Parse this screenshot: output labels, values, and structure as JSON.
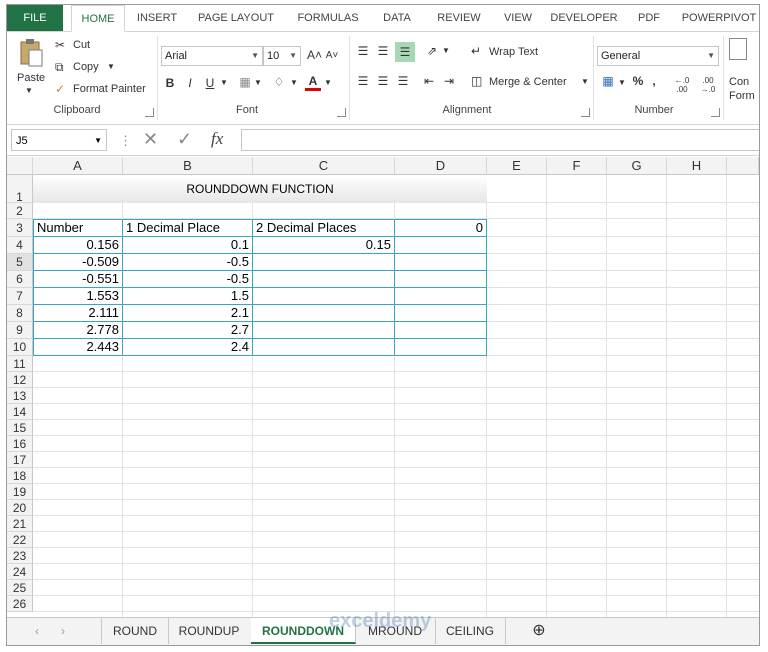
{
  "ribbon_tabs": [
    "FILE",
    "HOME",
    "INSERT",
    "PAGE LAYOUT",
    "FORMULAS",
    "DATA",
    "REVIEW",
    "VIEW",
    "DEVELOPER",
    "PDF",
    "POWERPIVOT"
  ],
  "clipboard": {
    "paste": "Paste",
    "cut": "Cut",
    "copy": "Copy",
    "format_painter": "Format Painter",
    "label": "Clipboard"
  },
  "font": {
    "name": "Arial",
    "size": "10",
    "label": "Font",
    "bold": "B",
    "italic": "I",
    "underline": "U",
    "grow": "A˄",
    "shrink": "A˅",
    "font_color": "A"
  },
  "alignment": {
    "wrap_text": "Wrap Text",
    "merge_center": "Merge & Center",
    "label": "Alignment"
  },
  "number": {
    "format": "General",
    "percent": "%",
    "comma": ",",
    "inc_decimal": "←.0 .00",
    "dec_decimal": ".00 →.0",
    "label": "Number"
  },
  "styles_partial": {
    "line1": "Con",
    "line2": "Form"
  },
  "formula_bar": {
    "name_box": "J5",
    "fx": "fx",
    "cancel": "✕",
    "enter": "✓",
    "more": "⋮",
    "value": ""
  },
  "columns": [
    "A",
    "B",
    "C",
    "D",
    "E",
    "F",
    "G",
    "H"
  ],
  "rows": [
    "1",
    "2",
    "3",
    "4",
    "5",
    "6",
    "7",
    "8",
    "9",
    "10",
    "11",
    "12",
    "13",
    "14",
    "15",
    "16",
    "17",
    "18",
    "19",
    "20",
    "21",
    "22",
    "23",
    "24",
    "25",
    "26"
  ],
  "sheet": {
    "title": "ROUNDDOWN FUNCTION",
    "headers": [
      "Number",
      "1 Decimal Place",
      "2 Decimal Places",
      "0"
    ],
    "numbers": [
      "0.156",
      "-0.509",
      "-0.551",
      "1.553",
      "2.111",
      "2.778",
      "2.443"
    ],
    "one_decimal": [
      "0.1",
      "-0.5",
      "-0.5",
      "1.5",
      "2.1",
      "2.7",
      "2.4"
    ],
    "two_decimal_first": "0.15"
  },
  "sheet_tabs": [
    "ROUND",
    "ROUNDUP",
    "ROUNDDOWN",
    "MROUND",
    "CEILING"
  ],
  "active_sheet": "ROUNDDOWN",
  "watermark": "exceldemy",
  "colors": {
    "excel_green": "#217346",
    "table_border": "#37a6c5",
    "title_fill": "#f0f0f0"
  }
}
